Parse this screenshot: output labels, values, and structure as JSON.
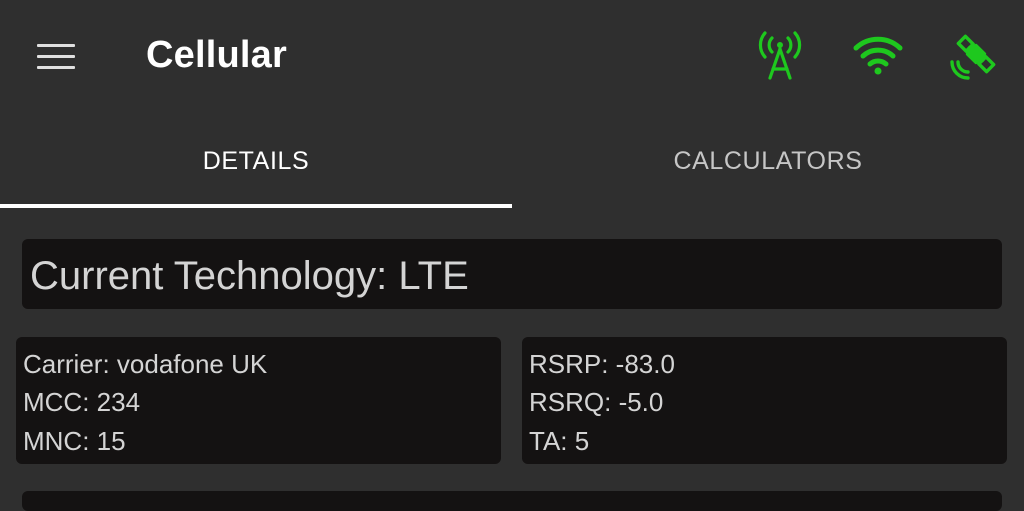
{
  "app_bar": {
    "title": "Cellular",
    "icons": {
      "menu": "hamburger-menu-icon",
      "cell": "cell-tower-icon",
      "wifi": "wifi-icon",
      "gps": "satellite-icon"
    },
    "icon_color": "#1ec81e"
  },
  "tabs": [
    {
      "label": "DETAILS",
      "active": true
    },
    {
      "label": "CALCULATORS",
      "active": false
    }
  ],
  "technology": {
    "text": "Current Technology: LTE"
  },
  "network_card": {
    "carrier": "Carrier: vodafone UK",
    "mcc": "MCC: 234",
    "mnc": "MNC: 15"
  },
  "signal_card": {
    "rsrp": "RSRP: -83.0",
    "rsrq": "RSRQ: -5.0",
    "ta": "TA: 5"
  }
}
